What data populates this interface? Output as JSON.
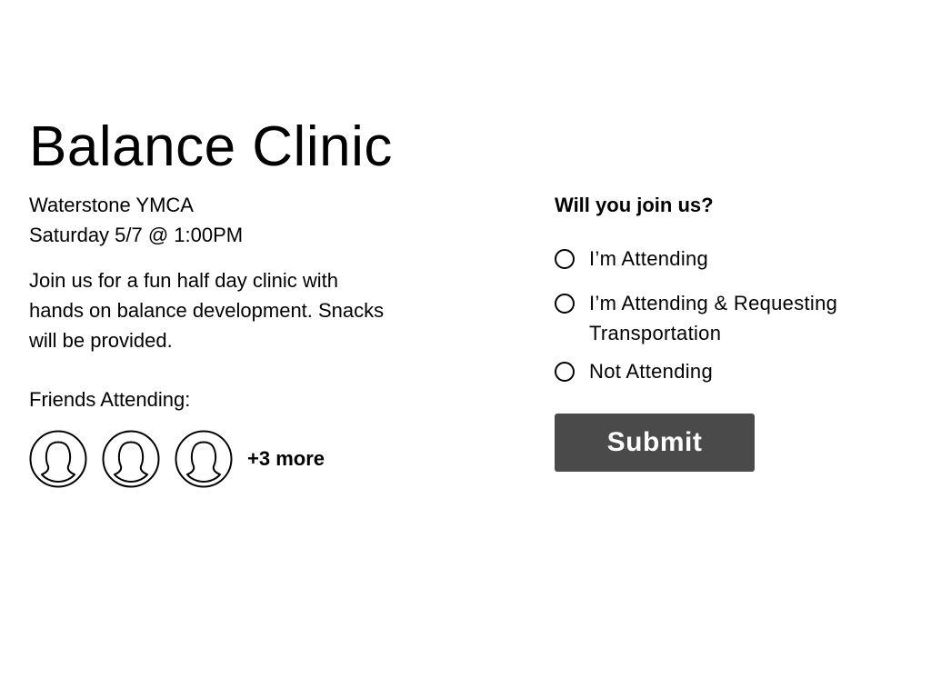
{
  "event": {
    "title": "Balance Clinic",
    "location": "Waterstone YMCA",
    "datetime": "Saturday 5/7 @ 1:00PM",
    "description": "Join us for a fun half day clinic with hands on balance development. Snacks will be provided."
  },
  "friends": {
    "label": "Friends Attending:",
    "avatars": [
      {
        "icon": "user-silhouette-icon"
      },
      {
        "icon": "user-silhouette-icon"
      },
      {
        "icon": "user-silhouette-icon"
      }
    ],
    "more_label": "+3 more"
  },
  "rsvp": {
    "question": "Will you join us?",
    "options": [
      {
        "label": "I’m Attending",
        "selected": false
      },
      {
        "label": "I’m Attending & Requesting Transportation",
        "selected": false
      },
      {
        "label": "Not Attending",
        "selected": false
      }
    ],
    "submit_label": "Submit"
  },
  "colors": {
    "text": "#000000",
    "button_bg": "#4a4a4a",
    "button_text": "#ffffff",
    "background": "#ffffff"
  }
}
